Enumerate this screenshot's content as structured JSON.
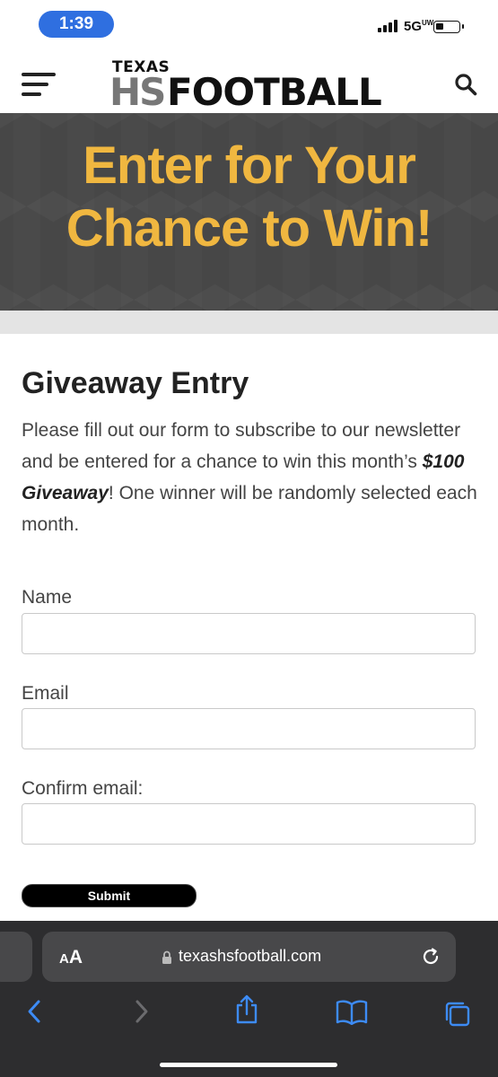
{
  "status_bar": {
    "time": "1:39",
    "network": "5G",
    "network_sup": "UW"
  },
  "header": {
    "logo_top": "TEXAS",
    "logo_hs": "HS",
    "logo_football": "FOOTBALL"
  },
  "hero": {
    "line1": "Enter for Your",
    "line2": "Chance to Win!",
    "text_color": "#f0b740"
  },
  "content": {
    "heading": "Giveaway Entry",
    "intro_before": "Please fill out our form to subscribe to our newsletter and be entered for a chance to win this month’s ",
    "intro_emphasis": "$100 Giveaway",
    "intro_after": "! One winner will be randomly selected each month."
  },
  "form": {
    "name_label": "Name",
    "name_value": "",
    "email_label": "Email",
    "email_value": "",
    "confirm_label": "Confirm email:",
    "confirm_value": "",
    "submit_label": "Submit"
  },
  "browser": {
    "aa_small": "A",
    "aa_large": "A",
    "url": "texashsfootball.com"
  },
  "icons": [
    "menu-icon",
    "search-icon",
    "lock-icon",
    "reload-icon",
    "back-icon",
    "forward-icon",
    "share-icon",
    "bookmarks-icon",
    "tabs-icon"
  ]
}
